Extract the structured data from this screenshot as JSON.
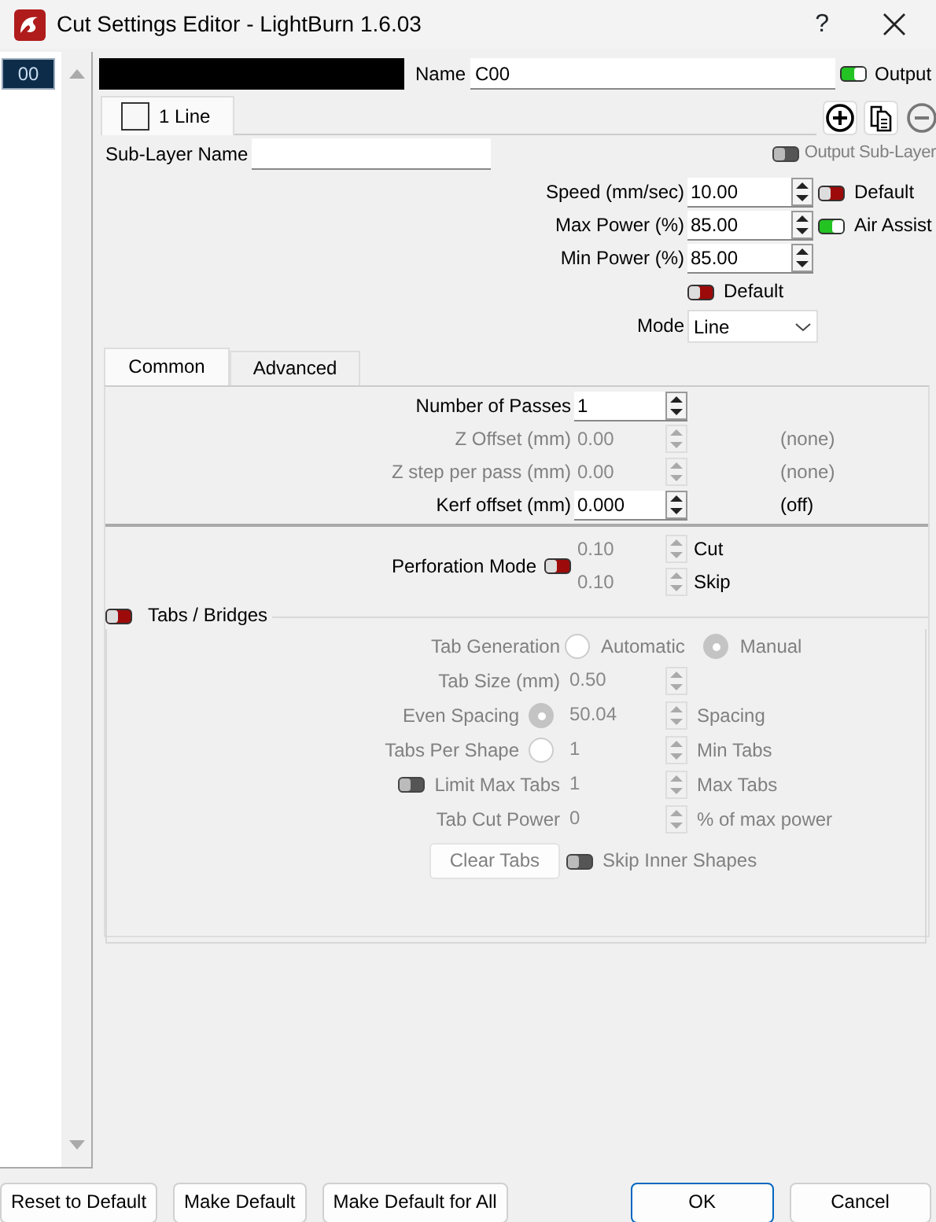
{
  "window": {
    "title": "Cut Settings Editor - LightBurn 1.6.03",
    "help": "?"
  },
  "layer_list": {
    "items": [
      {
        "label": "00",
        "selected": true
      }
    ]
  },
  "layer": {
    "color": "#000000",
    "name_label": "Name",
    "name_value": "C00",
    "output": {
      "label": "Output",
      "on": true
    }
  },
  "sublayer_tabs": [
    {
      "label": "1 Line",
      "selected": true
    }
  ],
  "sublayer_name": {
    "label": "Sub-Layer Name"
  },
  "output_sublayer": {
    "label": "Output Sub-Layer",
    "on": false,
    "disabled": true
  },
  "params": [
    {
      "label": "Speed (mm/sec)",
      "value": "10.00",
      "toggle": {
        "label": "Default",
        "on": false
      }
    },
    {
      "label": "Max Power (%)",
      "value": "85.00",
      "toggle": {
        "label": "Air Assist",
        "on": true
      }
    },
    {
      "label": "Min Power (%)",
      "value": "85.00"
    }
  ],
  "min_default": {
    "label": "Default",
    "on": false
  },
  "mode": {
    "label": "Mode",
    "value": "Line"
  },
  "tabs": [
    {
      "label": "Common",
      "selected": true
    },
    {
      "label": "Advanced",
      "selected": false
    }
  ],
  "passes": [
    {
      "label": "Number of Passes",
      "value": "1",
      "disabled": false
    },
    {
      "label": "Z Offset (mm)",
      "value": "0.00",
      "note": "(none)",
      "disabled": true
    },
    {
      "label": "Z step per pass (mm)",
      "value": "0.00",
      "note": "(none)",
      "disabled": true
    },
    {
      "label": "Kerf offset (mm)",
      "value": "0.000",
      "note": "(off)",
      "disabled": false
    }
  ],
  "perforation": {
    "label": "Perforation Mode",
    "on": false,
    "rows": [
      {
        "value": "0.10",
        "label": "Cut"
      },
      {
        "value": "0.10",
        "label": "Skip"
      }
    ]
  },
  "tabs_bridges": {
    "label": "Tabs / Bridges",
    "on": false,
    "generation": {
      "label": "Tab Generation",
      "options": [
        {
          "label": "Automatic",
          "selected": false
        },
        {
          "label": "Manual",
          "selected": true
        }
      ]
    },
    "rows": [
      {
        "kind": "plain",
        "label": "Tab Size (mm)",
        "value": "0.50"
      },
      {
        "kind": "radio",
        "label": "Even Spacing",
        "selected": true,
        "value": "50.04",
        "suffix": "Spacing"
      },
      {
        "kind": "radio",
        "label": "Tabs Per Shape",
        "selected": false,
        "value": "1",
        "suffix": "Min Tabs"
      },
      {
        "kind": "toggle",
        "label": "Limit Max Tabs",
        "on": false,
        "value": "1",
        "suffix": "Max Tabs"
      },
      {
        "kind": "plain",
        "label": "Tab Cut Power",
        "value": "0",
        "suffix": "% of max power"
      }
    ],
    "clear_button": "Clear Tabs",
    "skip_inner": {
      "label": "Skip Inner Shapes",
      "on": false
    }
  },
  "footer_buttons": [
    {
      "label": "Reset to Default",
      "kind": "normal"
    },
    {
      "label": "Make Default",
      "kind": "normal"
    },
    {
      "label": "Make Default for All",
      "kind": "normal"
    },
    {
      "label": "OK",
      "kind": "default"
    },
    {
      "label": "Cancel",
      "kind": "normal"
    }
  ]
}
